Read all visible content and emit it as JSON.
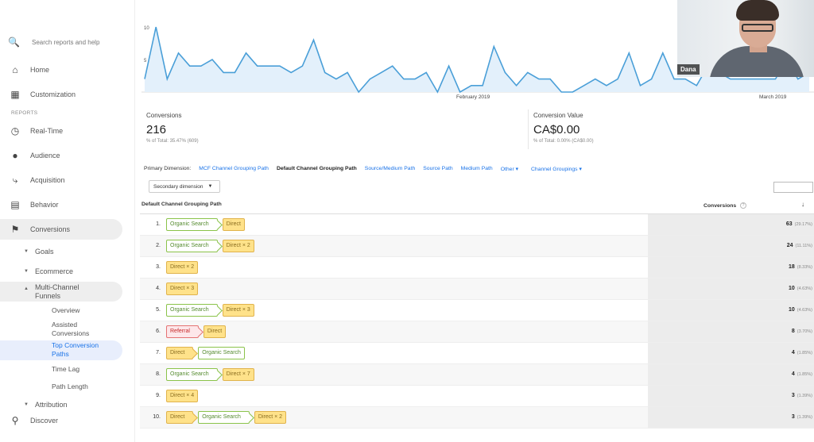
{
  "sidebar": {
    "search_placeholder": "Search reports and help",
    "home": "Home",
    "customization": "Customization",
    "reports_section": "REPORTS",
    "realtime": "Real-Time",
    "audience": "Audience",
    "acquisition": "Acquisition",
    "behavior": "Behavior",
    "conversions": "Conversions",
    "goals": "Goals",
    "ecommerce": "Ecommerce",
    "mcf_line1": "Multi-Channel",
    "mcf_line2": "Funnels",
    "overview": "Overview",
    "assisted_line1": "Assisted",
    "assisted_line2": "Conversions",
    "tcp_line1": "Top Conversion",
    "tcp_line2": "Paths",
    "time_lag": "Time Lag",
    "path_length": "Path Length",
    "attribution": "Attribution",
    "discover": "Discover"
  },
  "chart_data": {
    "type": "area",
    "x_tick_labels": [
      "February 2019",
      "March 2019"
    ],
    "y_tick_labels": [
      "10",
      "5"
    ],
    "values": [
      2,
      10,
      2,
      6,
      4,
      4,
      5,
      3,
      3,
      6,
      4,
      4,
      4,
      3,
      4,
      8,
      3,
      2,
      3,
      0,
      2,
      3,
      4,
      2,
      2,
      3,
      0,
      4,
      0,
      1,
      1,
      7,
      3,
      1,
      3,
      2,
      2,
      0,
      0,
      1,
      2,
      1,
      2,
      6,
      1,
      2,
      6,
      2,
      2,
      1,
      4,
      3,
      2,
      2,
      2,
      2,
      2,
      5,
      2,
      3
    ],
    "ylim": [
      0,
      10
    ],
    "color": "#4a9fd8"
  },
  "webcam": {
    "name": "Dana"
  },
  "metrics": {
    "conversions": {
      "label": "Conversions",
      "value": "216",
      "sub": "% of Total: 35.47% (609)"
    },
    "conversion_value": {
      "label": "Conversion Value",
      "value": "CA$0.00",
      "sub": "% of Total: 0.00% (CA$0.00)"
    }
  },
  "primary_dimension": {
    "label": "Primary Dimension:",
    "options": [
      "MCF Channel Grouping Path",
      "Default Channel Grouping Path",
      "Source/Medium Path",
      "Source Path",
      "Medium Path",
      "Other ▾",
      "Channel Groupings ▾"
    ]
  },
  "secondary_dimension": "Secondary dimension",
  "table": {
    "col_path": "Default Channel Grouping Path",
    "col_conversions": "Conversions",
    "rows": [
      {
        "num": "1.",
        "path": [
          [
            "Organic Search",
            "org"
          ],
          [
            "Direct",
            "dir"
          ]
        ],
        "conv": "63",
        "pct": "(29.17%)"
      },
      {
        "num": "2.",
        "path": [
          [
            "Organic Search",
            "org"
          ],
          [
            "Direct × 2",
            "dir"
          ]
        ],
        "conv": "24",
        "pct": "(11.11%)"
      },
      {
        "num": "3.",
        "path": [
          [
            "Direct × 2",
            "dir"
          ]
        ],
        "conv": "18",
        "pct": "(8.33%)"
      },
      {
        "num": "4.",
        "path": [
          [
            "Direct × 3",
            "dir"
          ]
        ],
        "conv": "10",
        "pct": "(4.63%)"
      },
      {
        "num": "5.",
        "path": [
          [
            "Organic Search",
            "org"
          ],
          [
            "Direct × 3",
            "dir"
          ]
        ],
        "conv": "10",
        "pct": "(4.63%)"
      },
      {
        "num": "6.",
        "path": [
          [
            "Referral",
            "ref"
          ],
          [
            "Direct",
            "dir"
          ]
        ],
        "conv": "8",
        "pct": "(3.70%)"
      },
      {
        "num": "7.",
        "path": [
          [
            "Direct",
            "dir"
          ],
          [
            "Organic Search",
            "org"
          ]
        ],
        "conv": "4",
        "pct": "(1.85%)"
      },
      {
        "num": "8.",
        "path": [
          [
            "Organic Search",
            "org"
          ],
          [
            "Direct × 7",
            "dir"
          ]
        ],
        "conv": "4",
        "pct": "(1.85%)"
      },
      {
        "num": "9.",
        "path": [
          [
            "Direct × 4",
            "dir"
          ]
        ],
        "conv": "3",
        "pct": "(1.39%)"
      },
      {
        "num": "10.",
        "path": [
          [
            "Direct",
            "dir"
          ],
          [
            "Organic Search",
            "org"
          ],
          [
            "Direct × 2",
            "dir"
          ]
        ],
        "conv": "3",
        "pct": "(1.39%)"
      }
    ]
  }
}
